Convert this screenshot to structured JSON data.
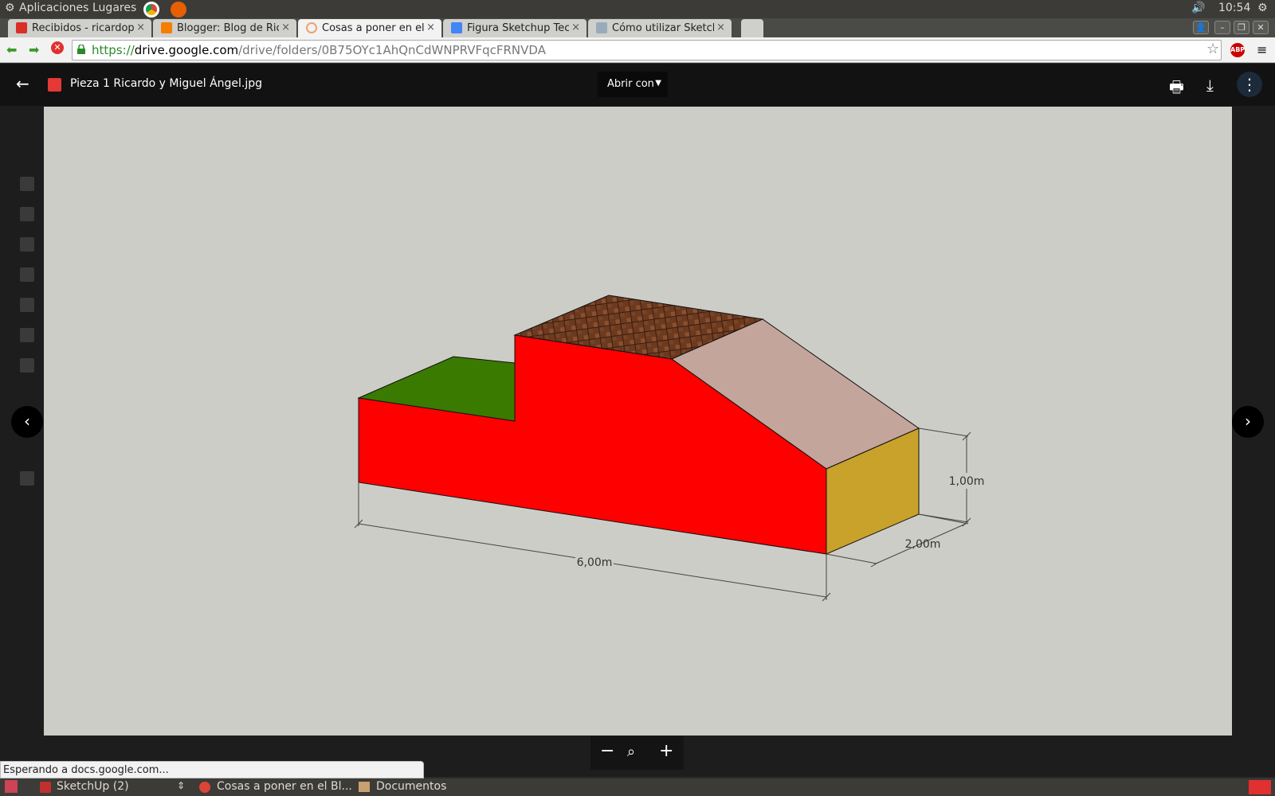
{
  "os_panel": {
    "applications": "Aplicaciones",
    "places": "Lugares",
    "time": "10:54"
  },
  "tabs": [
    {
      "title": "Recibidos - ricardop",
      "favicon_color": "#d93025"
    },
    {
      "title": "Blogger: Blog de Ric",
      "favicon_color": "#f57d00"
    },
    {
      "title": "Cosas a poner en el B",
      "favicon_color": "#f0a070",
      "active": true
    },
    {
      "title": "Figura Sketchup Tec",
      "favicon_color": "#4285f4"
    },
    {
      "title": "Cómo utilizar Sketch",
      "favicon_color": "#9ab"
    }
  ],
  "omnibox": {
    "scheme": "https://",
    "host": "drive.google.com",
    "path": "/drive/folders/0B75OYc1AhQnCdWNPRVFqcFRNVDA"
  },
  "viewer": {
    "file_name": "Pieza 1 Ricardo y Miguel Ángel.jpg",
    "open_with": "Abrir con",
    "icons": [
      "back-arrow-icon",
      "print-icon",
      "download-icon",
      "more-vert-icon"
    ]
  },
  "drawing": {
    "dim_length": "6,00m",
    "dim_width": "2,00m",
    "dim_height": "1,00m",
    "colors": {
      "front": "#ff0000",
      "low_top": "#3a7a00",
      "roof": "#6b3a1f",
      "slope": "#c4a59b",
      "end": "#c9a22b"
    }
  },
  "status": "Esperando a docs.google.com...",
  "taskbar": [
    "SketchUp (2)",
    "Cosas a poner en el Bl...",
    "Documentos"
  ]
}
